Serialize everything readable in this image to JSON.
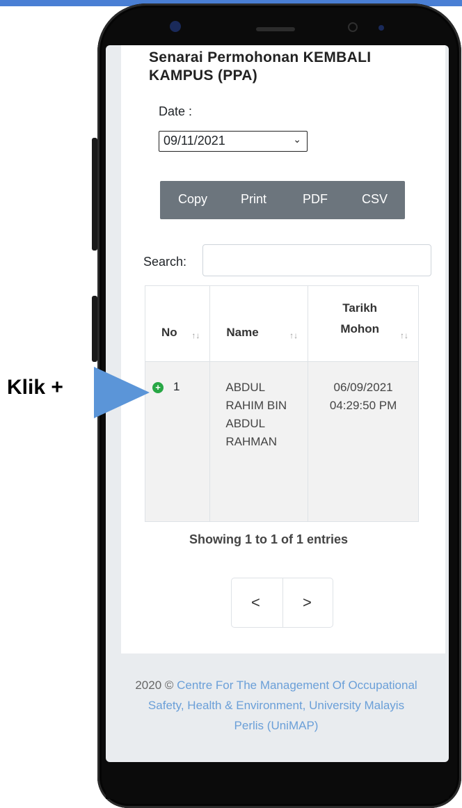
{
  "annotation": {
    "label": "Klik +"
  },
  "page": {
    "title": "Senarai Permohonan KEMBALI KAMPUS (PPA)"
  },
  "filter": {
    "date_label": "Date :",
    "date_value": "09/11/2021"
  },
  "export_buttons": [
    "Copy",
    "Print",
    "PDF",
    "CSV"
  ],
  "search": {
    "label": "Search:",
    "value": ""
  },
  "table": {
    "columns": [
      "No",
      "Name",
      "Tarikh Mohon"
    ],
    "rows": [
      {
        "no": "1",
        "name": "ABDUL RAHIM BIN ABDUL RAHMAN",
        "tarikh_mohon": "06/09/2021 04:29:50 PM"
      }
    ]
  },
  "pagination": {
    "info": "Showing 1 to 1 of 1 entries",
    "prev": "<",
    "next": ">"
  },
  "footer": {
    "prefix": "2020 ©",
    "link": "Centre For The Management Of Occupational Safety, Health & Environment, University Malayis Perlis (UniMAP)"
  },
  "colors": {
    "accent_blue": "#5b95d8",
    "button_gray": "#6c757d",
    "expand_green": "#28a745"
  }
}
